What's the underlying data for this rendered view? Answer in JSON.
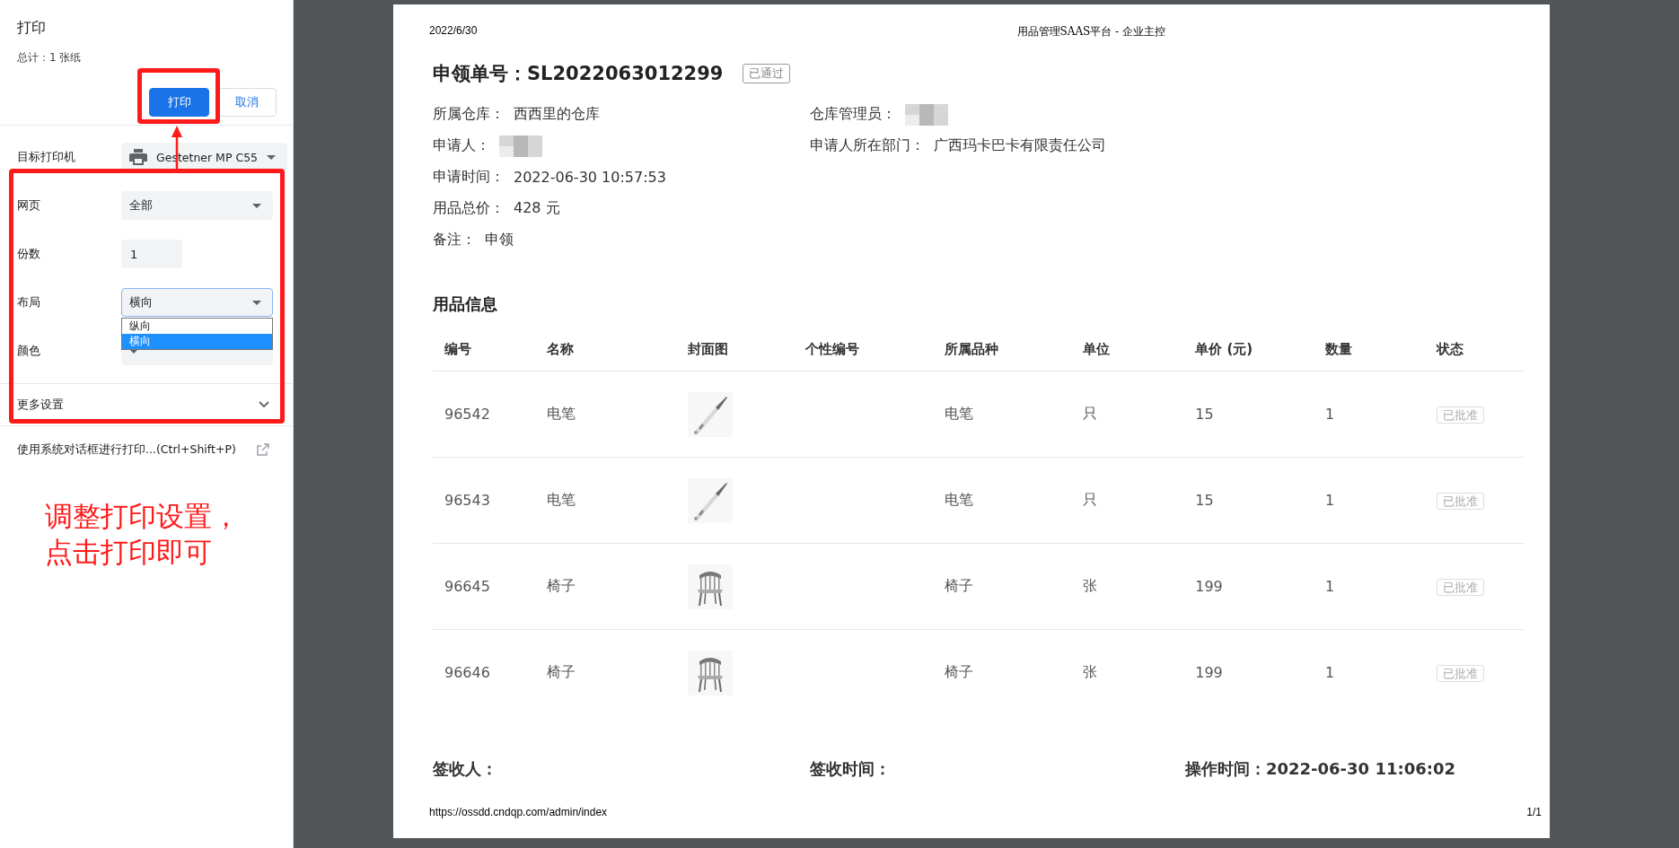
{
  "print_panel": {
    "title": "打印",
    "summary": "总计：1 张纸",
    "buttons": [
      {
        "label": "打印",
        "kind": "primary"
      },
      {
        "label": "取消",
        "kind": "secondary"
      }
    ],
    "settings": [
      {
        "label": "目标打印机",
        "kind": "printer",
        "value": "Gestetner MP C55"
      },
      {
        "label": "网页",
        "kind": "select",
        "value": "全部",
        "expanded": false
      },
      {
        "label": "份数",
        "kind": "input",
        "value": "1"
      },
      {
        "label": "布局",
        "kind": "select",
        "value": "横向",
        "expanded": true,
        "options": [
          {
            "label": "纵向",
            "selected": false
          },
          {
            "label": "横向",
            "selected": true
          }
        ]
      },
      {
        "label": "颜色",
        "kind": "select",
        "expanded": false
      }
    ],
    "more_settings": {
      "label": "更多设置",
      "expanded": false
    },
    "system_dialog_link": "使用系统对话框进行打印...(Ctrl+Shift+P)"
  },
  "annotation": {
    "lines": [
      "调整打印设置，",
      "点击打印即可"
    ]
  },
  "preview": {
    "header_date": "2022/6/30",
    "header_title": "用品管理SAAS平台 - 企业主控",
    "order": {
      "title": "申领单号：SL2022063012299",
      "status": "已通过"
    },
    "field_rows": [
      [
        {
          "label": "所属仓库：",
          "value": "西西里的仓库"
        },
        {
          "label": "仓库管理员：",
          "redacted": true
        }
      ],
      [
        {
          "label": "申请人：",
          "redacted": true
        },
        {
          "label": "申请人所在部门：",
          "value": "广西玛卡巴卡有限责任公司"
        }
      ],
      [
        {
          "label": "申请时间：",
          "value": "2022-06-30 10:57:53"
        }
      ],
      [
        {
          "label": "用品总价：",
          "value": "428 元"
        }
      ],
      [
        {
          "label": "备注：",
          "value": "申领"
        }
      ]
    ],
    "section_title": "用品信息",
    "table": {
      "columns": [
        "编号",
        "名称",
        "封面图",
        "个性编号",
        "所属品种",
        "单位",
        "单价 (元)",
        "数量",
        "状态"
      ],
      "rows": [
        {
          "id": "96542",
          "name": "电笔",
          "category": "电笔",
          "unit": "只",
          "price": "15",
          "quantity": "1",
          "status": "已批准"
        },
        {
          "id": "96543",
          "name": "电笔",
          "category": "电笔",
          "unit": "只",
          "price": "15",
          "quantity": "1",
          "status": "已批准"
        },
        {
          "id": "96645",
          "name": "椅子",
          "category": "椅子",
          "unit": "张",
          "price": "199",
          "quantity": "1",
          "status": "已批准"
        },
        {
          "id": "96646",
          "name": "椅子",
          "category": "椅子",
          "unit": "张",
          "price": "199",
          "quantity": "1",
          "status": "已批准"
        }
      ]
    },
    "signatures": [
      "签收人：",
      "签收时间：",
      "操作时间：2022-06-30 11:06:02"
    ],
    "footer_url": "https://ossdd.cndqp.com/admin/index",
    "page_number": "1/1"
  }
}
